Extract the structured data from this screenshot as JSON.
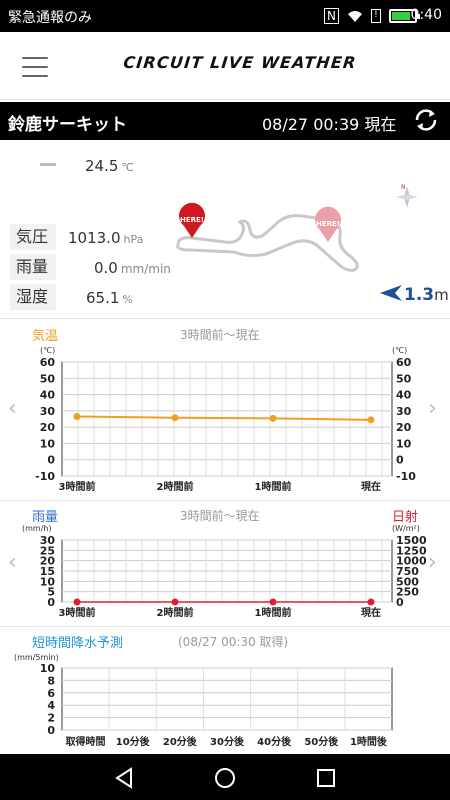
{
  "status_bar": {
    "left_text": "緊急通報のみ",
    "time": "0:40"
  },
  "header": {
    "title": "CIRCUIT LIVE WEATHER"
  },
  "circuit": {
    "name": "鈴鹿サーキット",
    "timestamp": "08/27 00:39 現在"
  },
  "info": {
    "temperature": "24.5",
    "temperature_unit": "℃",
    "rows": [
      {
        "label": "気圧",
        "value": "1013.0",
        "unit": "hPa"
      },
      {
        "label": "雨量",
        "value": "0.0",
        "unit": "mm/min"
      },
      {
        "label": "湿度",
        "value": "65.1",
        "unit": "%"
      }
    ],
    "wind": {
      "value": "1.3",
      "unit": "m"
    },
    "map_markers": [
      "HERE!",
      "HERE!"
    ],
    "compass_label": "N"
  },
  "colors": {
    "temp": "#f0a020",
    "rain": "#2a6fd0",
    "solar": "#e02030",
    "forecast": "#2196d6"
  },
  "chart_data": [
    {
      "type": "line",
      "title": "気温",
      "subtitle": "3時間前〜現在",
      "y_unit_left": "(℃)",
      "y_unit_right": "(℃)",
      "x_labels": [
        "3時間前",
        "2時間前",
        "1時間前",
        "現在"
      ],
      "y_ticks": [
        "60",
        "50",
        "40",
        "30",
        "20",
        "10",
        "0",
        "-10"
      ],
      "ylim": [
        -10,
        60
      ],
      "x": [
        0,
        1,
        2,
        3
      ],
      "values": [
        26.5,
        25.8,
        25.4,
        24.5
      ],
      "grid": true
    },
    {
      "type": "line",
      "title_left": "雨量",
      "title_right": "日射",
      "subtitle": "3時間前〜現在",
      "y_unit_left": "(mm/h)",
      "y_unit_right": "(W/m²)",
      "x_labels": [
        "3時間前",
        "2時間前",
        "1時間前",
        "現在"
      ],
      "y_ticks_left": [
        "30",
        "25",
        "20",
        "15",
        "10",
        "5",
        "0"
      ],
      "y_ticks_right": [
        "1500",
        "1250",
        "1000",
        "750",
        "500",
        "250",
        "0"
      ],
      "ylim": [
        0,
        30
      ],
      "x": [
        0,
        1,
        2,
        3
      ],
      "values": [
        0,
        0,
        0,
        0
      ],
      "grid": true
    },
    {
      "type": "bar",
      "title": "短時間降水予測",
      "subtitle": "(08/27 00:30 取得)",
      "y_unit_left": "(mm/5min)",
      "y_ticks": [
        "10",
        "8",
        "6",
        "4",
        "2",
        "0"
      ],
      "ylim": [
        0,
        10
      ],
      "categories": [
        "取得時間",
        "10分後",
        "20分後",
        "30分後",
        "40分後",
        "50分後",
        "1時間後"
      ],
      "values": [
        0,
        0,
        0,
        0,
        0,
        0,
        0
      ],
      "grid": true
    }
  ]
}
